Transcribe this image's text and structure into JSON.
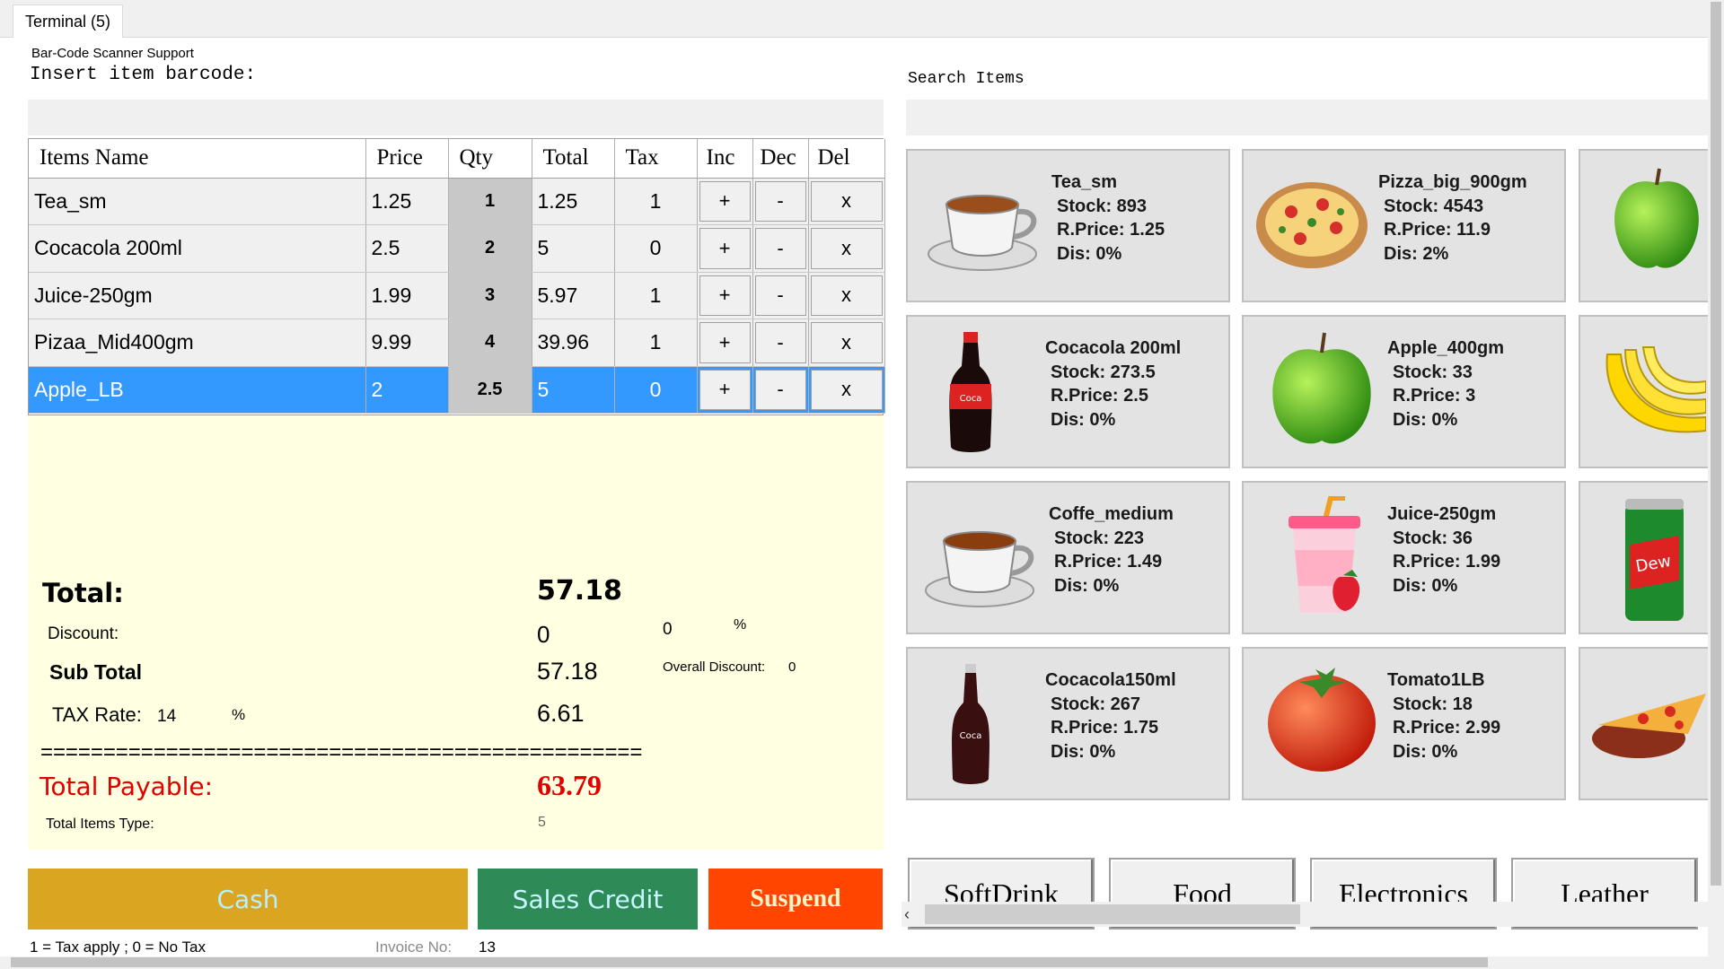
{
  "tab": {
    "label": "Terminal (5)"
  },
  "barcode": {
    "caption": "Bar-Code Scanner Support",
    "prompt": "Insert item barcode:",
    "value": ""
  },
  "search": {
    "label": "Search Items",
    "value": ""
  },
  "grid": {
    "headers": [
      "Items Name",
      "Price",
      "Qty",
      "Total",
      "Tax",
      "Inc",
      "Dec",
      "Del"
    ],
    "buttons": {
      "inc": "+",
      "dec": "-",
      "del": "x"
    },
    "rows": [
      {
        "name": "Tea_sm",
        "price": "1.25",
        "qty": "1",
        "total": "1.25",
        "tax": "1"
      },
      {
        "name": "Cocacola 200ml",
        "price": "2.5",
        "qty": "2",
        "total": "5",
        "tax": "0"
      },
      {
        "name": "Juice-250gm",
        "price": "1.99",
        "qty": "3",
        "total": "5.97",
        "tax": "1"
      },
      {
        "name": "Pizaa_Mid400gm",
        "price": "9.99",
        "qty": "4",
        "total": "39.96",
        "tax": "1"
      },
      {
        "name": "Apple_LB",
        "price": "2",
        "qty": "2.5",
        "total": "5",
        "tax": "0"
      }
    ]
  },
  "summary": {
    "total_label": "Total:",
    "total_value": "57.18",
    "discount_label": "Discount:",
    "discount_value": "0",
    "discount_percent_value": "0",
    "percent_sign": "%",
    "subtotal_label": "Sub Total",
    "subtotal_value": "57.18",
    "overall_discount_label": "Overall Discount:",
    "overall_discount_value": "0",
    "tax_rate_label": "TAX Rate:",
    "tax_rate_value": "14",
    "tax_value": "6.61",
    "separator": "================================================",
    "payable_label": "Total Payable:",
    "payable_value": "63.79",
    "items_type_label": "Total Items Type:",
    "items_type_value": "5"
  },
  "actions": {
    "cash": "Cash",
    "sales_credit": "Sales Credit",
    "suspend": "Suspend"
  },
  "footer": {
    "tax_note": "1 = Tax apply ; 0 = No Tax",
    "invoice_label": "Invoice No:",
    "invoice_value": "13"
  },
  "products": [
    {
      "name": "Tea_sm",
      "stock": "Stock: 893",
      "price": "R.Price: 1.25",
      "dis": "Dis: 0%",
      "icon": "teacup-icon"
    },
    {
      "name": "Pizza_big_900gm",
      "stock": "Stock: 4543",
      "price": "R.Price: 11.9",
      "dis": "Dis: 2%",
      "icon": "pizza-icon"
    },
    {
      "name": "Cocacola 200ml",
      "stock": "Stock: 273.5",
      "price": "R.Price: 2.5",
      "dis": "Dis: 0%",
      "icon": "soda-bottle-icon"
    },
    {
      "name": "Apple_400gm",
      "stock": "Stock: 33",
      "price": "R.Price: 3",
      "dis": "Dis: 0%",
      "icon": "green-apple-icon"
    },
    {
      "name": "Coffe_medium",
      "stock": "Stock: 223",
      "price": "R.Price: 1.49",
      "dis": "Dis: 0%",
      "icon": "coffee-cup-icon"
    },
    {
      "name": "Juice-250gm",
      "stock": "Stock: 36",
      "price": "R.Price: 1.99",
      "dis": "Dis: 0%",
      "icon": "juice-cup-icon"
    },
    {
      "name": "Cocacola150ml",
      "stock": "Stock: 267",
      "price": "R.Price: 1.75",
      "dis": "Dis: 0%",
      "icon": "glass-bottle-icon"
    },
    {
      "name": "Tomato1LB",
      "stock": "Stock: 18",
      "price": "R.Price: 2.99",
      "dis": "Dis: 0%",
      "icon": "tomato-icon"
    }
  ],
  "categories": [
    "SoftDrink",
    "Food",
    "Electronics",
    "Leather"
  ],
  "colors": {
    "cash": "#daa520",
    "sales_credit": "#2e8b57",
    "suspend": "#ff4500",
    "selected_row": "#3399ff",
    "summary_bg": "#ffffe1",
    "payable": "#e00000"
  }
}
